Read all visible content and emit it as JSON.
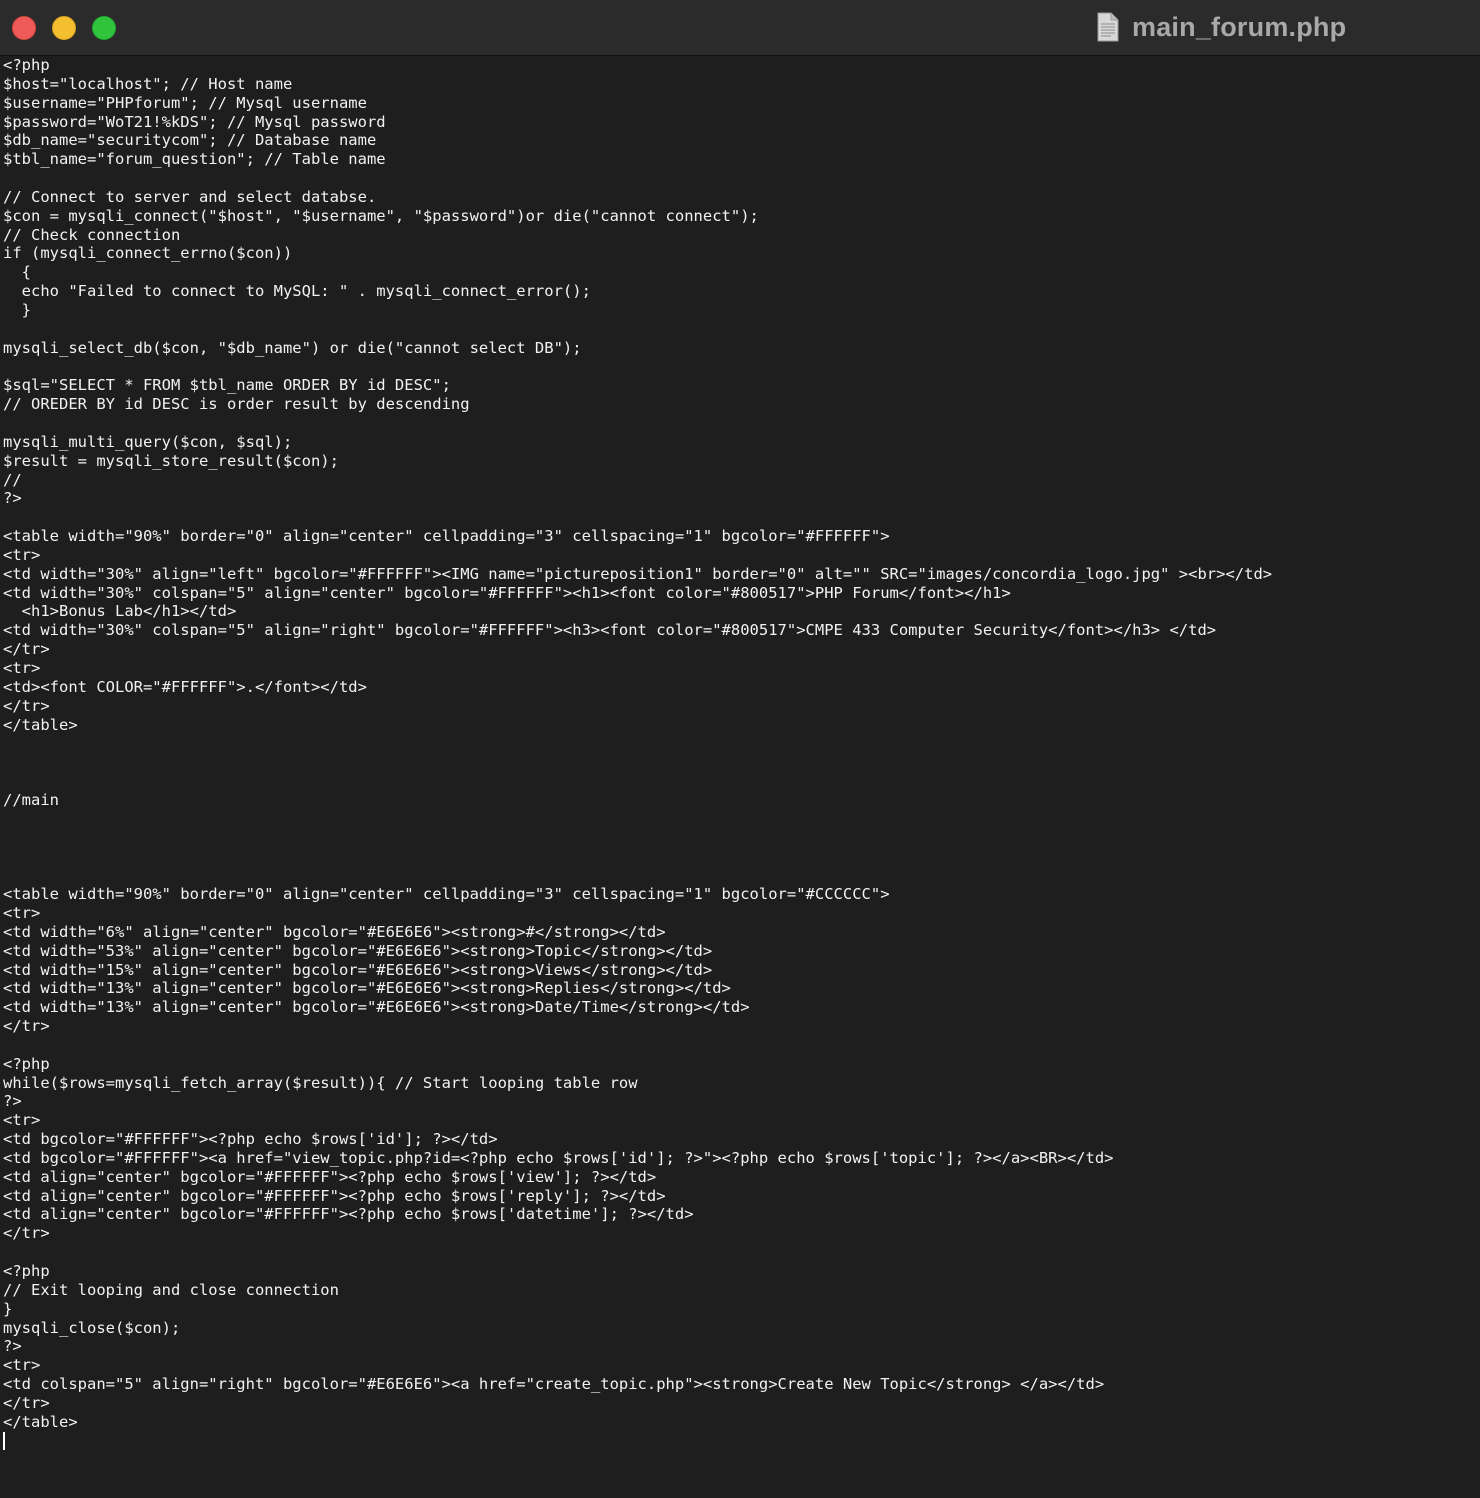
{
  "window": {
    "title": "main_forum.php",
    "file_icon": "document-icon",
    "traffic_lights": {
      "close_color": "#ee5b58",
      "minimize_color": "#f4bf2f",
      "zoom_color": "#30c43d"
    }
  },
  "editor": {
    "background_color": "#1e1e1e",
    "text_color": "#f2f2f2",
    "lines": [
      "<?php",
      "$host=\"localhost\"; // Host name",
      "$username=\"PHPforum\"; // Mysql username",
      "$password=\"WoT21!%kDS\"; // Mysql password",
      "$db_name=\"securitycom\"; // Database name",
      "$tbl_name=\"forum_question\"; // Table name",
      "",
      "// Connect to server and select databse.",
      "$con = mysqli_connect(\"$host\", \"$username\", \"$password\")or die(\"cannot connect\");",
      "// Check connection",
      "if (mysqli_connect_errno($con))",
      "  {",
      "  echo \"Failed to connect to MySQL: \" . mysqli_connect_error();",
      "  }",
      "",
      "mysqli_select_db($con, \"$db_name\") or die(\"cannot select DB\");",
      "",
      "$sql=\"SELECT * FROM $tbl_name ORDER BY id DESC\";",
      "// OREDER BY id DESC is order result by descending",
      "",
      "mysqli_multi_query($con, $sql);",
      "$result = mysqli_store_result($con);",
      "//",
      "?>",
      "",
      "<table width=\"90%\" border=\"0\" align=\"center\" cellpadding=\"3\" cellspacing=\"1\" bgcolor=\"#FFFFFF\">",
      "<tr>",
      "<td width=\"30%\" align=\"left\" bgcolor=\"#FFFFFF\"><IMG name=\"pictureposition1\" border=\"0\" alt=\"\" SRC=\"images/concordia_logo.jpg\" ><br></td>",
      "<td width=\"30%\" colspan=\"5\" align=\"center\" bgcolor=\"#FFFFFF\"><h1><font color=\"#800517\">PHP Forum</font></h1>",
      "  <h1>Bonus Lab</h1></td>",
      "<td width=\"30%\" colspan=\"5\" align=\"right\" bgcolor=\"#FFFFFF\"><h3><font color=\"#800517\">CMPE 433 Computer Security</font></h3> </td>",
      "</tr>",
      "<tr>",
      "<td><font COLOR=\"#FFFFFF\">.</font></td>",
      "</tr>",
      "</table>",
      "",
      "",
      "",
      "//main",
      "",
      "",
      "",
      "",
      "<table width=\"90%\" border=\"0\" align=\"center\" cellpadding=\"3\" cellspacing=\"1\" bgcolor=\"#CCCCCC\">",
      "<tr>",
      "<td width=\"6%\" align=\"center\" bgcolor=\"#E6E6E6\"><strong>#</strong></td>",
      "<td width=\"53%\" align=\"center\" bgcolor=\"#E6E6E6\"><strong>Topic</strong></td>",
      "<td width=\"15%\" align=\"center\" bgcolor=\"#E6E6E6\"><strong>Views</strong></td>",
      "<td width=\"13%\" align=\"center\" bgcolor=\"#E6E6E6\"><strong>Replies</strong></td>",
      "<td width=\"13%\" align=\"center\" bgcolor=\"#E6E6E6\"><strong>Date/Time</strong></td>",
      "</tr>",
      "",
      "<?php",
      "while($rows=mysqli_fetch_array($result)){ // Start looping table row",
      "?>",
      "<tr>",
      "<td bgcolor=\"#FFFFFF\"><?php echo $rows['id']; ?></td>",
      "<td bgcolor=\"#FFFFFF\"><a href=\"view_topic.php?id=<?php echo $rows['id']; ?>\"><?php echo $rows['topic']; ?></a><BR></td>",
      "<td align=\"center\" bgcolor=\"#FFFFFF\"><?php echo $rows['view']; ?></td>",
      "<td align=\"center\" bgcolor=\"#FFFFFF\"><?php echo $rows['reply']; ?></td>",
      "<td align=\"center\" bgcolor=\"#FFFFFF\"><?php echo $rows['datetime']; ?></td>",
      "</tr>",
      "",
      "<?php",
      "// Exit looping and close connection",
      "}",
      "mysqli_close($con);",
      "?>",
      "<tr>",
      "<td colspan=\"5\" align=\"right\" bgcolor=\"#E6E6E6\"><a href=\"create_topic.php\"><strong>Create New Topic</strong> </a></td>",
      "</tr>",
      "</table>",
      ""
    ]
  }
}
